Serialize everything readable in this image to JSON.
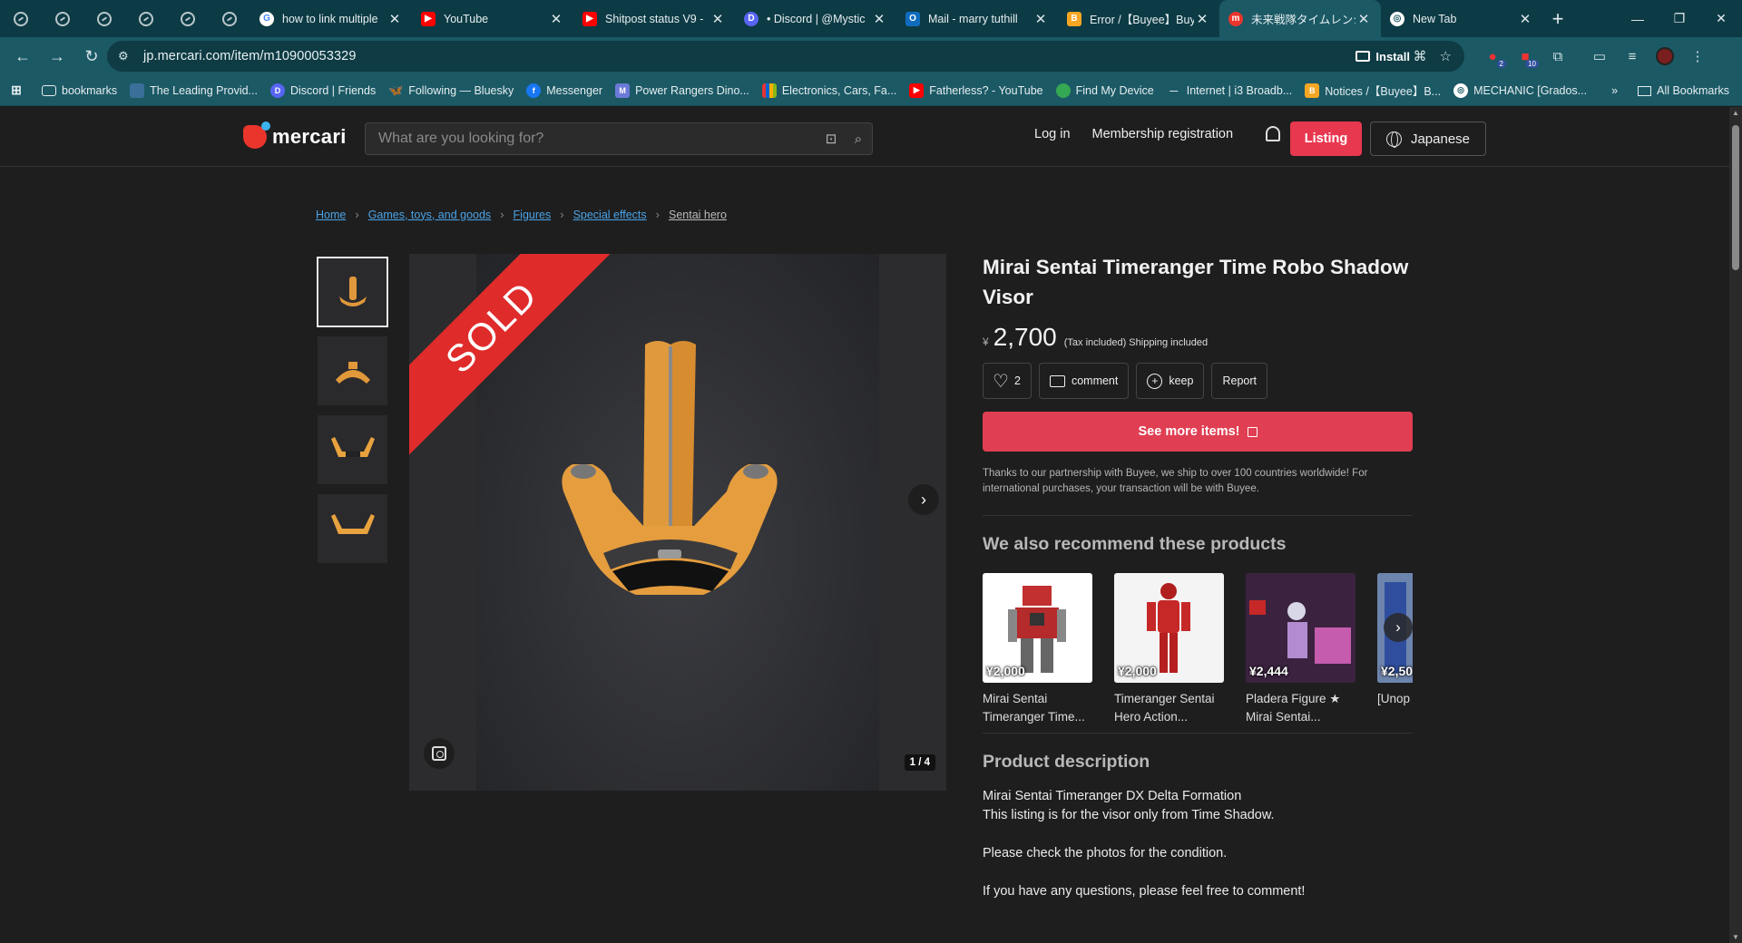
{
  "browser": {
    "tabs": [
      {
        "title": "how to link multiple",
        "favicon": "google-icon",
        "color": "#ffffff"
      },
      {
        "title": "YouTube",
        "favicon": "youtube-icon",
        "color": "#ff0000"
      },
      {
        "title": "Shitpost status V9 -",
        "favicon": "youtube-icon",
        "color": "#ff0000"
      },
      {
        "title": "• Discord | @Mystic",
        "favicon": "discord-icon",
        "color": "#5865f2"
      },
      {
        "title": "Mail - marry tuthill",
        "favicon": "outlook-icon",
        "color": "#0f6cbd"
      },
      {
        "title": "Error /【Buyee】Buy",
        "favicon": "buyee-icon",
        "color": "#f5a623"
      },
      {
        "title": "未来戦隊タイムレンジ",
        "favicon": "mercari-icon",
        "color": "#ea352d"
      },
      {
        "title": "New Tab",
        "favicon": "chrome-icon",
        "color": "#ffffff"
      }
    ],
    "url": "jp.mercari.com/item/m10900053329",
    "install_label": "Install",
    "bookmarks": [
      {
        "label": "bookmarks",
        "icon": "folder-icon"
      },
      {
        "label": "The Leading Provid...",
        "icon": "bookmark-site-icon"
      },
      {
        "label": "Discord | Friends",
        "icon": "discord-icon"
      },
      {
        "label": "Following — Bluesky",
        "icon": "bluesky-icon"
      },
      {
        "label": "Messenger",
        "icon": "facebook-icon"
      },
      {
        "label": "Power Rangers Dino...",
        "icon": "bookmark-site-icon"
      },
      {
        "label": "Electronics, Cars, Fa...",
        "icon": "ebay-icon"
      },
      {
        "label": "Fatherless? - YouTube",
        "icon": "youtube-icon"
      },
      {
        "label": "Find My Device",
        "icon": "find-device-icon"
      },
      {
        "label": "Internet | i3 Broadb...",
        "icon": "i3-icon"
      },
      {
        "label": "Notices /【Buyee】B...",
        "icon": "buyee-icon"
      },
      {
        "label": "MECHANIC [Grados...",
        "icon": "chrome-icon"
      }
    ],
    "all_bookmarks_label": "All Bookmarks",
    "ext_badges": [
      "2",
      "10"
    ]
  },
  "header": {
    "logo_text": "mercari",
    "search_placeholder": "What are you looking for?",
    "login": "Log in",
    "membership": "Membership registration",
    "listing": "Listing",
    "language": "Japanese"
  },
  "breadcrumb": [
    "Home",
    "Games, toys, and goods",
    "Figures",
    "Special effects",
    "Sentai hero"
  ],
  "gallery": {
    "sold_label": "SOLD",
    "counter": "1 / 4",
    "thumb_count": 4
  },
  "product": {
    "title": "Mirai Sentai Timeranger Time Robo Shadow Visor",
    "currency": "¥",
    "price": "2,700",
    "tax_note": "(Tax included) Shipping included",
    "likes": "2",
    "comment_label": "comment",
    "keep_label": "keep",
    "report_label": "Report",
    "cta_label": "See more items!",
    "partner_note": "Thanks to our partnership with Buyee, we ship to over 100 countries worldwide! For international purchases, your transaction will be with Buyee."
  },
  "recommend": {
    "heading": "We also recommend these products",
    "items": [
      {
        "price": "¥2,000",
        "name": "Mirai Sentai Timeranger Time..."
      },
      {
        "price": "¥2,000",
        "name": "Timeranger Sentai Hero Action..."
      },
      {
        "price": "¥2,444",
        "name": "Pladera Figure ★ Mirai Sentai..."
      },
      {
        "price": "¥2,50",
        "name": "[Unop Senta"
      }
    ]
  },
  "description": {
    "heading": "Product description",
    "lines": [
      "Mirai Sentai Timeranger DX Delta Formation",
      "This listing is for the visor only from Time Shadow.",
      "",
      "Please check the photos for the condition.",
      "",
      "If you have any questions, please feel free to comment!"
    ]
  },
  "colors": {
    "accent": "#e8384f",
    "link": "#4aa3e8",
    "sold": "#e02b2b",
    "chrome_tabbar": "#0d3b45",
    "chrome_toolbar": "#1b5965"
  }
}
